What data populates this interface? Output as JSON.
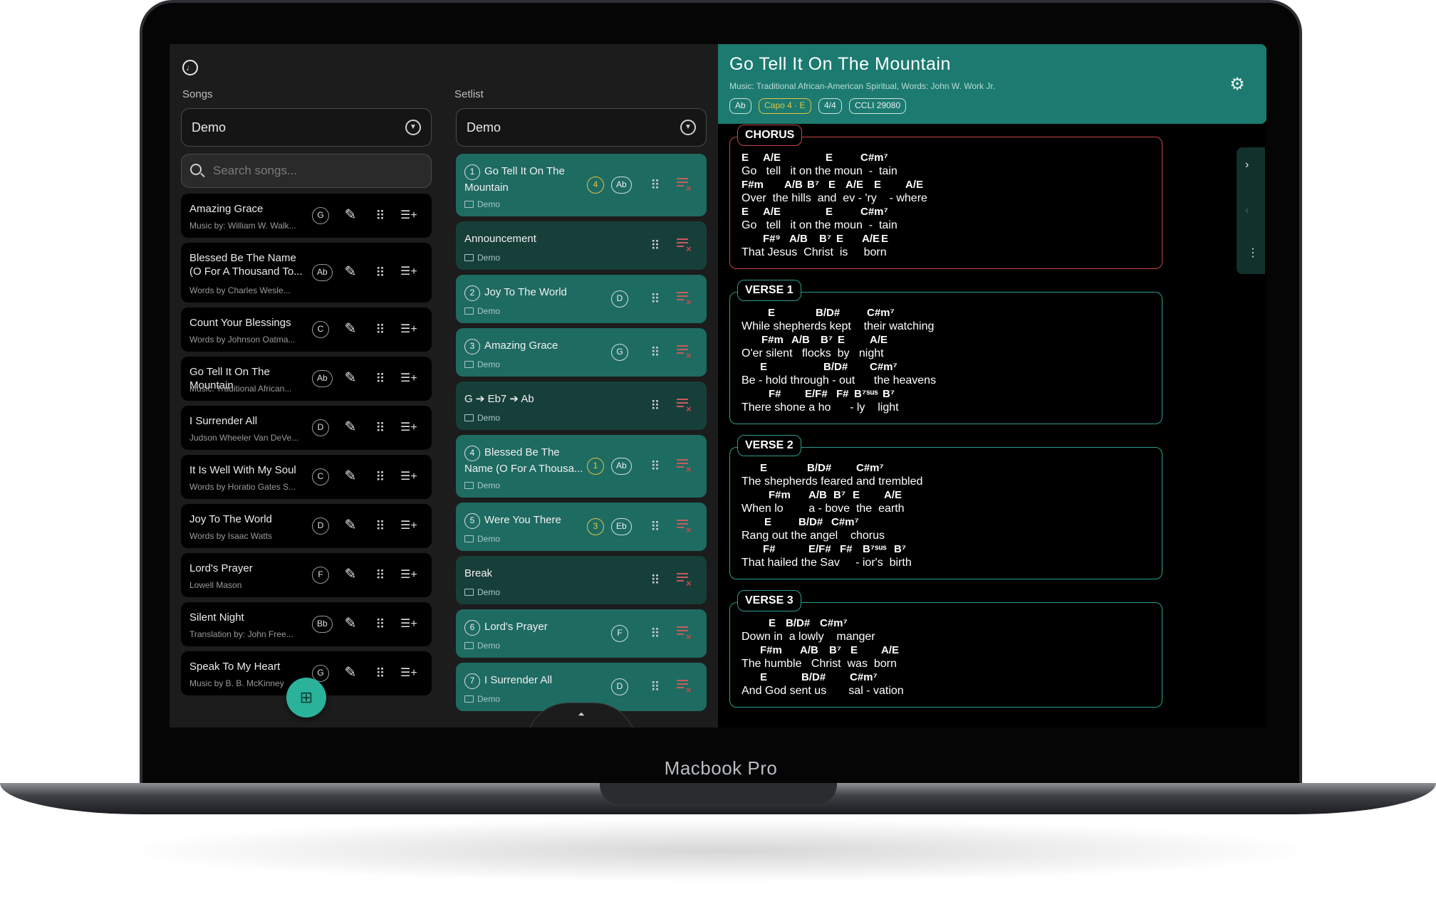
{
  "device": {
    "label": "Macbook Pro"
  },
  "songs_panel": {
    "label": "Songs",
    "selected": "Demo",
    "search_placeholder": "Search songs...",
    "items": [
      {
        "title": "Amazing Grace",
        "sub": "Music by: William W. Walk...",
        "key": "G"
      },
      {
        "title": "Blessed Be The Name (O For A Thousand To...",
        "sub": "Words by Charles Wesle...",
        "key": "Ab"
      },
      {
        "title": "Count Your Blessings",
        "sub": "Words by Johnson Oatma...",
        "key": "C"
      },
      {
        "title": "Go Tell It On The Mountain",
        "sub": "Music: Traditional African...",
        "key": "Ab"
      },
      {
        "title": "I Surrender All",
        "sub": "Judson Wheeler Van DeVe...",
        "key": "D"
      },
      {
        "title": "It Is Well With My Soul",
        "sub": "Words by Horatio Gates S...",
        "key": "C"
      },
      {
        "title": "Joy To The World",
        "sub": "Words by Isaac Watts",
        "key": "D"
      },
      {
        "title": "Lord's Prayer",
        "sub": "Lowell Mason",
        "key": "F"
      },
      {
        "title": "Silent Night",
        "sub": "Translation by: John Free...",
        "key": "Bb"
      },
      {
        "title": "Speak To My Heart",
        "sub": "Music by B. B. McKinney",
        "key": "G"
      }
    ]
  },
  "setlist_panel": {
    "label": "Setlist",
    "selected": "Demo",
    "folder": "Demo",
    "items": [
      {
        "num": "1",
        "title": "Go Tell It On The Mountain",
        "capo": "4",
        "key": "Ab"
      },
      {
        "title": "Announcement"
      },
      {
        "num": "2",
        "title": "Joy To The World",
        "key": "D"
      },
      {
        "num": "3",
        "title": "Amazing Grace",
        "key": "G"
      },
      {
        "title": "G ➔ Eb7 ➔ Ab"
      },
      {
        "num": "4",
        "title": "Blessed Be The Name (O For A Thousa...",
        "capo": "1",
        "key": "Ab"
      },
      {
        "num": "5",
        "title": "Were You There",
        "capo": "3",
        "key": "Eb"
      },
      {
        "title": "Break"
      },
      {
        "num": "6",
        "title": "Lord's Prayer",
        "key": "F"
      },
      {
        "num": "7",
        "title": "I Surrender All",
        "key": "D"
      }
    ]
  },
  "song_view": {
    "title": "Go Tell It On The Mountain",
    "credit": "Music: Traditional African-American Spiritual, Words: John W. Work Jr.",
    "key": "Ab",
    "capo": "Capo  4  ·  E",
    "time": "4/4",
    "ccli": "CCLI 29080",
    "sections": [
      {
        "label": "CHORUS",
        "style": "chorus",
        "lines": [
          {
            "lyric": "Go   tell   it on the moun  -  tain",
            "chords": [
              [
                "E",
                0
              ],
              [
                "A/E",
                30
              ],
              [
                "E",
                118
              ],
              [
                "C#m⁷",
                167
              ]
            ]
          },
          {
            "lyric": "Over  the hills  and  ev - 'ry    - where",
            "chords": [
              [
                "F#m",
                0
              ],
              [
                "A/B",
                60
              ],
              [
                "B⁷",
                92
              ],
              [
                "E",
                122
              ],
              [
                "A/E",
                146
              ],
              [
                "E",
                186
              ],
              [
                "A/E",
                230
              ]
            ]
          },
          {
            "lyric": "Go   tell   it on the moun  -  tain",
            "chords": [
              [
                "E",
                0
              ],
              [
                "A/E",
                30
              ],
              [
                "E",
                118
              ],
              [
                "C#m⁷",
                167
              ]
            ]
          },
          {
            "lyric": "That Jesus  Christ  is     born",
            "chords": [
              [
                "F#⁹",
                30
              ],
              [
                "A/B",
                67
              ],
              [
                "B⁷",
                109
              ],
              [
                "E",
                133
              ],
              [
                "A/E",
                169
              ],
              [
                "E",
                196
              ]
            ]
          }
        ]
      },
      {
        "label": "VERSE 1",
        "style": "verse",
        "lines": [
          {
            "lyric": "While shepherds kept    their watching",
            "chords": [
              [
                "E",
                37
              ],
              [
                "B/D#",
                104
              ],
              [
                "C#m⁷",
                176
              ]
            ]
          },
          {
            "lyric": "O'er silent   flocks  by   night",
            "chords": [
              [
                "F#m",
                28
              ],
              [
                "A/B",
                70
              ],
              [
                "B⁷",
                111
              ],
              [
                "E",
                135
              ],
              [
                "A/E",
                180
              ]
            ]
          },
          {
            "lyric": "Be - hold through - out      the heavens",
            "chords": [
              [
                "E",
                26
              ],
              [
                "B/D#",
                115
              ],
              [
                "C#m⁷",
                180
              ]
            ]
          },
          {
            "lyric": "There shone a ho      - ly    light",
            "chords": [
              [
                "F#",
                38
              ],
              [
                "E/F#",
                89
              ],
              [
                "F#",
                133
              ],
              [
                "B⁷ˢᵘˢ",
                158
              ],
              [
                "B⁷",
                198
              ]
            ]
          }
        ]
      },
      {
        "label": "VERSE 2",
        "style": "verse",
        "lines": [
          {
            "lyric": "The shepherds feared and trembled",
            "chords": [
              [
                "E",
                26
              ],
              [
                "B/D#",
                92
              ],
              [
                "C#m⁷",
                161
              ]
            ]
          },
          {
            "lyric": "When lo        a - bove  the  earth",
            "chords": [
              [
                "F#m",
                38
              ],
              [
                "A/B",
                94
              ],
              [
                "B⁷",
                129
              ],
              [
                "E",
                156
              ],
              [
                "A/E",
                200
              ]
            ]
          },
          {
            "lyric": "Rang out the angel    chorus",
            "chords": [
              [
                "E",
                32
              ],
              [
                "B/D#",
                80
              ],
              [
                "C#m⁷",
                126
              ]
            ]
          },
          {
            "lyric": "That hailed the Sav     - ior's  birth",
            "chords": [
              [
                "F#",
                30
              ],
              [
                "E/F#",
                94
              ],
              [
                "F#",
                138
              ],
              [
                "B⁷ˢᵘˢ",
                170
              ],
              [
                "B⁷",
                214
              ]
            ]
          }
        ]
      },
      {
        "label": "VERSE 3",
        "style": "verse",
        "lines": [
          {
            "lyric": "Down in  a lowly    manger",
            "chords": [
              [
                "E",
                38
              ],
              [
                "B/D#",
                62
              ],
              [
                "C#m⁷",
                110
              ]
            ]
          },
          {
            "lyric": "The humble   Christ  was  born",
            "chords": [
              [
                "F#m",
                26
              ],
              [
                "A/B",
                82
              ],
              [
                "B⁷",
                123
              ],
              [
                "E",
                153
              ],
              [
                "A/E",
                196
              ]
            ]
          },
          {
            "lyric": "And God sent us       sal - vation",
            "chords": [
              [
                "E",
                26
              ],
              [
                "B/D#",
                84
              ],
              [
                "C#m⁷",
                152
              ]
            ]
          }
        ]
      }
    ]
  },
  "icons": {
    "next": "›",
    "prev": "‹",
    "more": "⋮",
    "gear": "⚙",
    "handle": "⏶"
  }
}
